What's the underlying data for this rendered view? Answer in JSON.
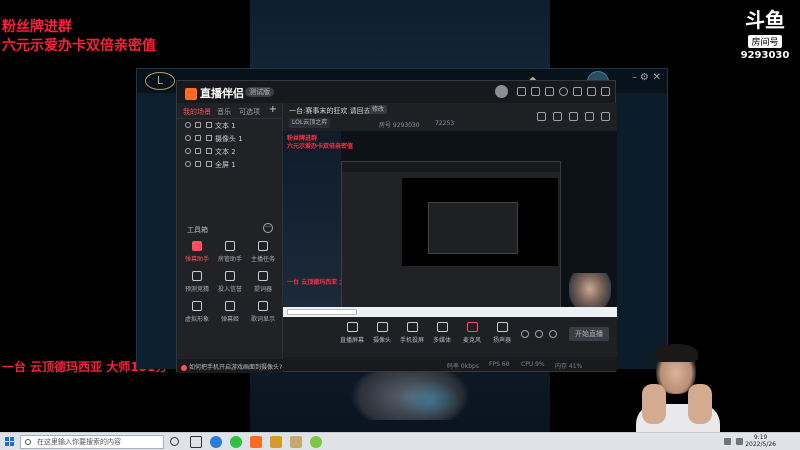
{
  "overlay": {
    "line1": "粉丝牌进群",
    "line2": "六元示爱办卡双倍亲密值",
    "line3": "一台 云顶德玛西亚 大师151分"
  },
  "douyu": {
    "logo": "斗鱼",
    "tag": "房间号",
    "room_number": "9293030"
  },
  "lol": {
    "logo": "L"
  },
  "obs": {
    "brand": "直播伴侣",
    "version": "测试版",
    "tabs": [
      "我的场景",
      "音乐",
      "可选项"
    ],
    "sources": [
      "文本 1",
      "摄像头 1",
      "文本 2",
      "全屏 1"
    ],
    "toolbox_title": "工具箱",
    "tools": [
      {
        "label": "弹幕助手",
        "highlight": true
      },
      {
        "label": "房管助手",
        "highlight": false
      },
      {
        "label": "主播任务",
        "highlight": false
      },
      {
        "label": "预测竞猜",
        "highlight": false
      },
      {
        "label": "投入信誉",
        "highlight": false
      },
      {
        "label": "提词器",
        "highlight": false
      },
      {
        "label": "虚拟形象",
        "highlight": false
      },
      {
        "label": "弹幕姬",
        "highlight": false
      },
      {
        "label": "歌词显示",
        "highlight": false
      }
    ],
    "notice": "如何把手机开启游戏画面到摄像头?",
    "room_title": "一台:赛事末的狂欢 请回去我",
    "edit_label": "修改",
    "category": "LOL云顶之弈",
    "meta_room": "房号 9293030",
    "meta_fans": "72253",
    "preview_red_1": "粉丝牌进群",
    "preview_red_2": "六元示爱办卡双倍亲密值",
    "preview_red_3": "一台 云顶德玛西亚 大师151分",
    "controls": [
      "直播屏幕",
      "摄像头",
      "手机投屏",
      "多媒体",
      "麦克风",
      "扬声器"
    ],
    "start_label": "开始直播",
    "status": [
      "码率 0kbps",
      "FPS 60",
      "CPU 9%",
      "内存 41%"
    ]
  },
  "taskbar": {
    "search_placeholder": "在这里输入你要搜索的内容",
    "time": "9:19",
    "date": "2022/5/26"
  },
  "colors": {
    "overlay_red": "#ff1e3c",
    "accent": "#ff4f5e",
    "brand_orange": "#ff6a1f"
  }
}
